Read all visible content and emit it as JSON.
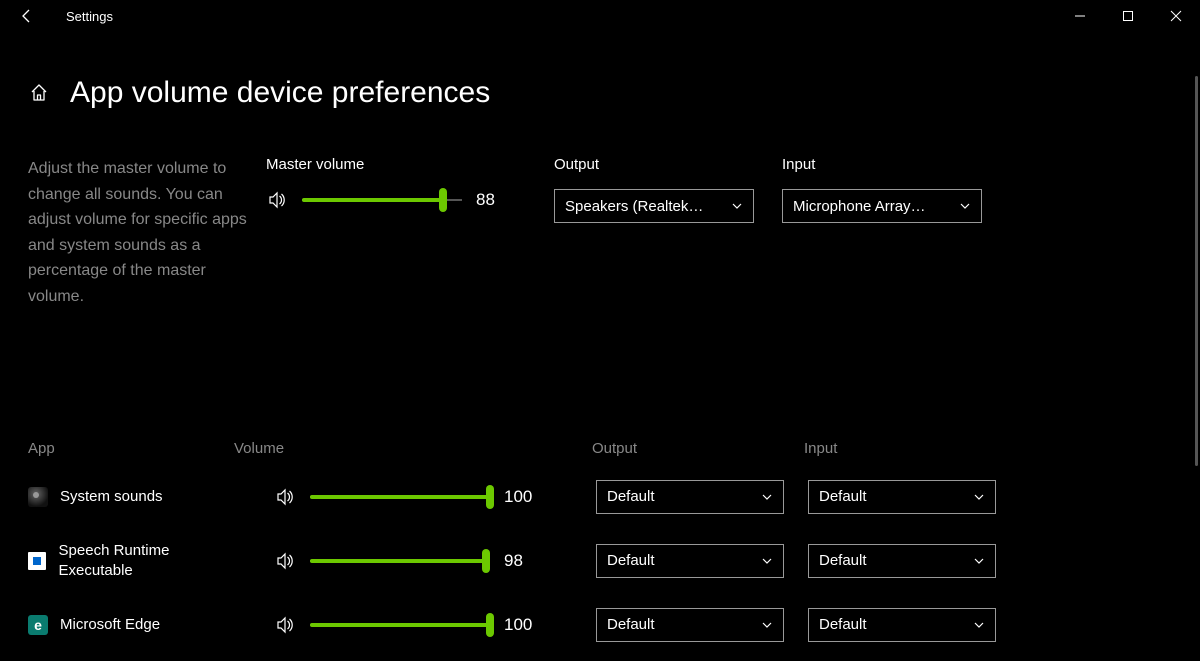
{
  "window": {
    "title": "Settings"
  },
  "page": {
    "title": "App volume  device preferences",
    "description": "Adjust the master volume to change all sounds. You can adjust volume for specific apps and system sounds as a percentage of the master volume."
  },
  "master": {
    "volume_label": "Master volume",
    "volume_value": "88",
    "volume_percent": 88,
    "output_label": "Output",
    "output_selected": "Speakers (Realtek…",
    "input_label": "Input",
    "input_selected": "Microphone Array…"
  },
  "app_headers": {
    "app": "App",
    "volume": "Volume",
    "output": "Output",
    "input": "Input"
  },
  "apps": [
    {
      "name": "System sounds",
      "icon": "system",
      "volume": 100,
      "volume_str": "100",
      "output": "Default",
      "input": "Default"
    },
    {
      "name": "Speech Runtime Executable",
      "icon": "speech",
      "volume": 98,
      "volume_str": "98",
      "output": "Default",
      "input": "Default"
    },
    {
      "name": "Microsoft Edge",
      "icon": "edge",
      "volume": 100,
      "volume_str": "100",
      "output": "Default",
      "input": "Default"
    }
  ]
}
